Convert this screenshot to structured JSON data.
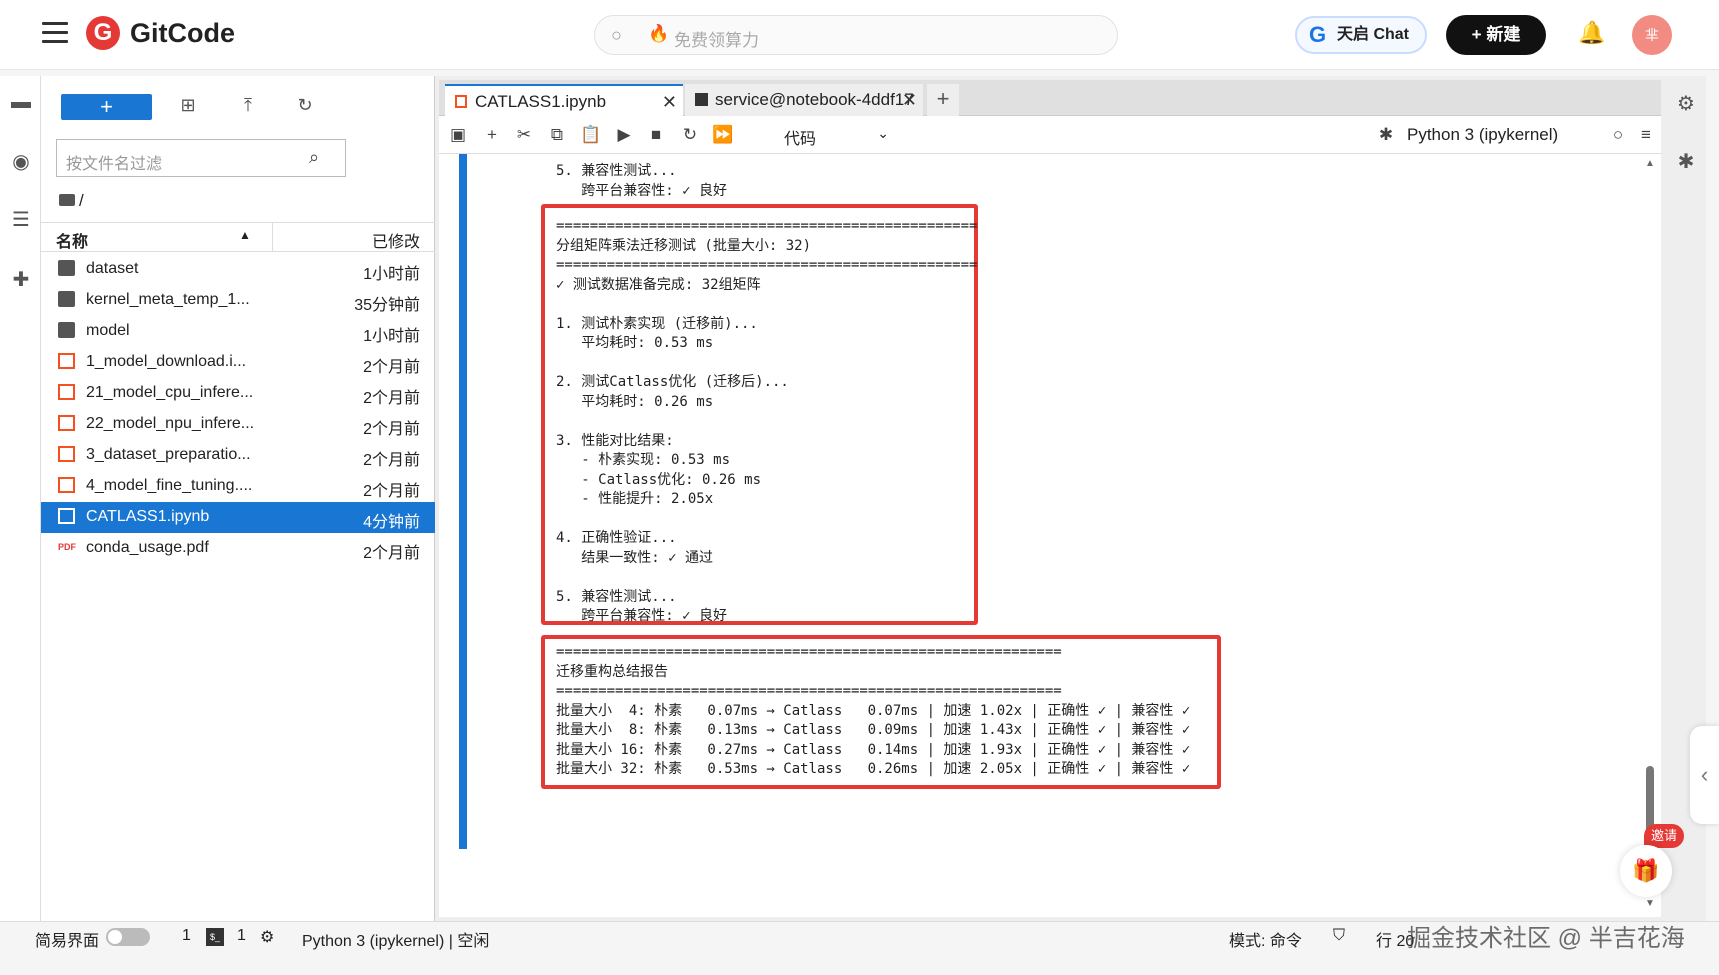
{
  "topbar": {
    "logo_text": "GitCode",
    "search_placeholder": "免费领算力",
    "chat_label": "天启 Chat",
    "new_label": "+ 新建",
    "avatar_text": "芈"
  },
  "filebrowser": {
    "new_label": "+",
    "filter_placeholder": "按文件名过滤",
    "breadcrumb": "/",
    "col_name": "名称",
    "col_modified": "已修改",
    "files": [
      {
        "name": "dataset",
        "modified": "1小时前",
        "type": "folder"
      },
      {
        "name": "kernel_meta_temp_1...",
        "modified": "35分钟前",
        "type": "folder"
      },
      {
        "name": "model",
        "modified": "1小时前",
        "type": "folder"
      },
      {
        "name": "1_model_download.i...",
        "modified": "2个月前",
        "type": "notebook"
      },
      {
        "name": "21_model_cpu_infere...",
        "modified": "2个月前",
        "type": "notebook"
      },
      {
        "name": "22_model_npu_infere...",
        "modified": "2个月前",
        "type": "notebook"
      },
      {
        "name": "3_dataset_preparatio...",
        "modified": "2个月前",
        "type": "notebook"
      },
      {
        "name": "4_model_fine_tuning....",
        "modified": "2个月前",
        "type": "notebook"
      },
      {
        "name": "CATLASS1.ipynb",
        "modified": "4分钟前",
        "type": "notebook",
        "selected": true
      },
      {
        "name": "conda_usage.pdf",
        "modified": "2个月前",
        "type": "pdf"
      }
    ]
  },
  "tabs": [
    {
      "label": "CATLASS1.ipynb",
      "active": true
    },
    {
      "label": "service@notebook-4ddf17",
      "active": false
    }
  ],
  "toolbar": {
    "cell_type": "代码",
    "kernel": "Python 3 (ipykernel)"
  },
  "output": {
    "top_part": "5. 兼容性测试...\n   跨平台兼容性: ✓ 良好",
    "box1": "==================================================\n分组矩阵乘法迁移测试 (批量大小: 32)\n==================================================\n✓ 测试数据准备完成: 32组矩阵\n\n1. 测试朴素实现 (迁移前)...\n   平均耗时: 0.53 ms\n\n2. 测试Catlass优化 (迁移后)...\n   平均耗时: 0.26 ms\n\n3. 性能对比结果:\n   - 朴素实现: 0.53 ms\n   - Catlass优化: 0.26 ms\n   - 性能提升: 2.05x\n\n4. 正确性验证...\n   结果一致性: ✓ 通过\n\n5. 兼容性测试...\n   跨平台兼容性: ✓ 良好",
    "box2": "============================================================\n迁移重构总结报告\n============================================================\n批量大小  4: 朴素   0.07ms → Catlass   0.07ms | 加速 1.02x | 正确性 ✓ | 兼容性 ✓\n批量大小  8: 朴素   0.13ms → Catlass   0.09ms | 加速 1.43x | 正确性 ✓ | 兼容性 ✓\n批量大小 16: 朴素   0.27ms → Catlass   0.14ms | 加速 1.93x | 正确性 ✓ | 兼容性 ✓\n批量大小 32: 朴素   0.53ms → Catlass   0.26ms | 加速 2.05x | 正确性 ✓ | 兼容性 ✓"
  },
  "statusbar": {
    "simple_mode": "简易界面",
    "count1": "1",
    "count2": "1",
    "kernel_status": "Python 3 (ipykernel) | 空闲",
    "mode": "模式: 命令",
    "line": "行 20"
  },
  "invite_label": "邀请",
  "watermark": "掘金技术社区 @ 半吉花海",
  "colors": {
    "accent": "#1976d2",
    "highlight": "#e53935"
  }
}
